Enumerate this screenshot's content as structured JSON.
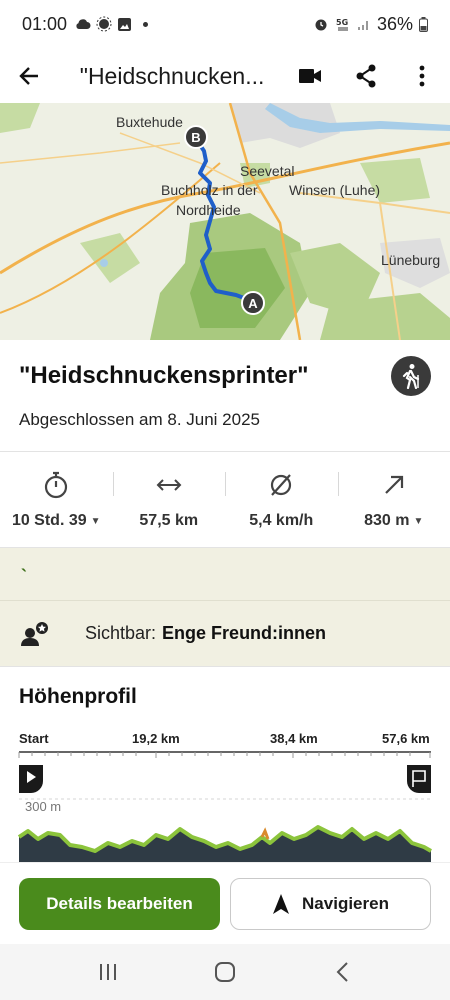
{
  "status_bar": {
    "time": "01:00",
    "battery": "36%",
    "icons": [
      "cloud-icon",
      "weather-icon",
      "gallery-icon",
      "alarm-icon",
      "5g-icon",
      "signal-icon",
      "battery-icon"
    ]
  },
  "app_bar": {
    "title": "\"Heidschnucken...",
    "icons": [
      "back-arrow-icon",
      "video-camera-icon",
      "share-icon",
      "more-vert-icon"
    ]
  },
  "map": {
    "labels": [
      "Buxtehude",
      "Seevetal",
      "Buchholz in der",
      "Nordheide",
      "Winsen (Luhe)",
      "Lüneburg"
    ],
    "start_marker": "A",
    "end_marker": "B",
    "colors": {
      "route": "#1f5fc9",
      "forest": "#a9c97f",
      "forest_dark": "#8ab85e",
      "road": "#f2b24c",
      "water": "#a7cde8"
    }
  },
  "tour": {
    "name": "\"Heidschnuckensprinter\"",
    "completed": "Abgeschlossen am 8. Juni 2025",
    "sport_icon": "hiking-icon"
  },
  "stats": [
    {
      "icon": "stopwatch-icon",
      "value": "10 Std. 39",
      "dropdown": true
    },
    {
      "icon": "distance-arrows-icon",
      "value": "57,5 km",
      "dropdown": false
    },
    {
      "icon": "average-speed-icon",
      "value": "5,4 km/h",
      "dropdown": false
    },
    {
      "icon": "uphill-arrow-icon",
      "value": "830 m",
      "dropdown": true
    }
  ],
  "band": {
    "mark": "`"
  },
  "visibility": {
    "label": "Sichtbar:",
    "value": "Enge Freund:innen",
    "icon": "friend-star-icon"
  },
  "elevation": {
    "title": "Höhenprofil",
    "axis_labels": [
      "Start",
      "19,2 km",
      "38,4 km",
      "57,6 km"
    ],
    "y_label": "300 m",
    "start_icon": "play-flag-icon",
    "end_icon": "finish-flag-icon"
  },
  "buttons": {
    "edit": "Details bearbeiten",
    "navigate": "Navigieren"
  },
  "colors": {
    "accent": "#4a8b1c",
    "band": "#f1f0e2",
    "profile_fill": "#2f3b45",
    "profile_line": "#8cc43c"
  }
}
